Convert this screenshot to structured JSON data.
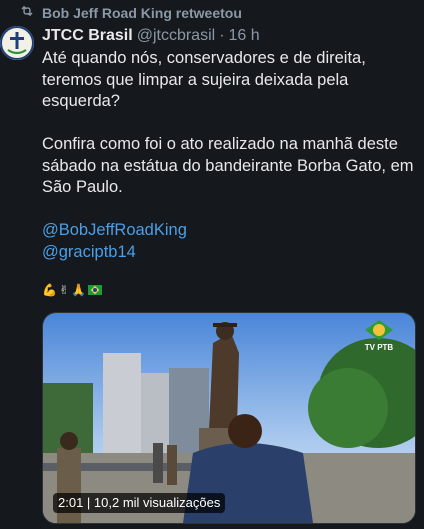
{
  "retweet": {
    "icon": "retweet-icon",
    "label": "Bob Jeff Road King retweetou"
  },
  "tweet": {
    "author_name": "JTCC Brasil",
    "author_handle": "@jtccbrasil",
    "separator": "·",
    "time": "16 h",
    "paragraph1": "Até quando nós, conservadores e de direita, teremos que limpar a sujeira deixada pela esquerda?",
    "paragraph2": "Confira como foi o ato realizado na manhã deste sábado na estátua do bandeirante Borba Gato, em São Paulo.",
    "mentions": [
      "@BobJeffRoadKing",
      "@graciptb14"
    ],
    "emojis": [
      "💪",
      "✌",
      "🙏",
      "🇧🇷"
    ]
  },
  "media": {
    "view_info": "2:01 | 10,2 mil visualizações",
    "channel_logo_text": "TV PTB",
    "channel_logo_top": "PTB14"
  },
  "colors": {
    "background": "#15181c",
    "text": "#e7e9ea",
    "muted": "#8b98a5",
    "link": "#4a9fe8"
  }
}
